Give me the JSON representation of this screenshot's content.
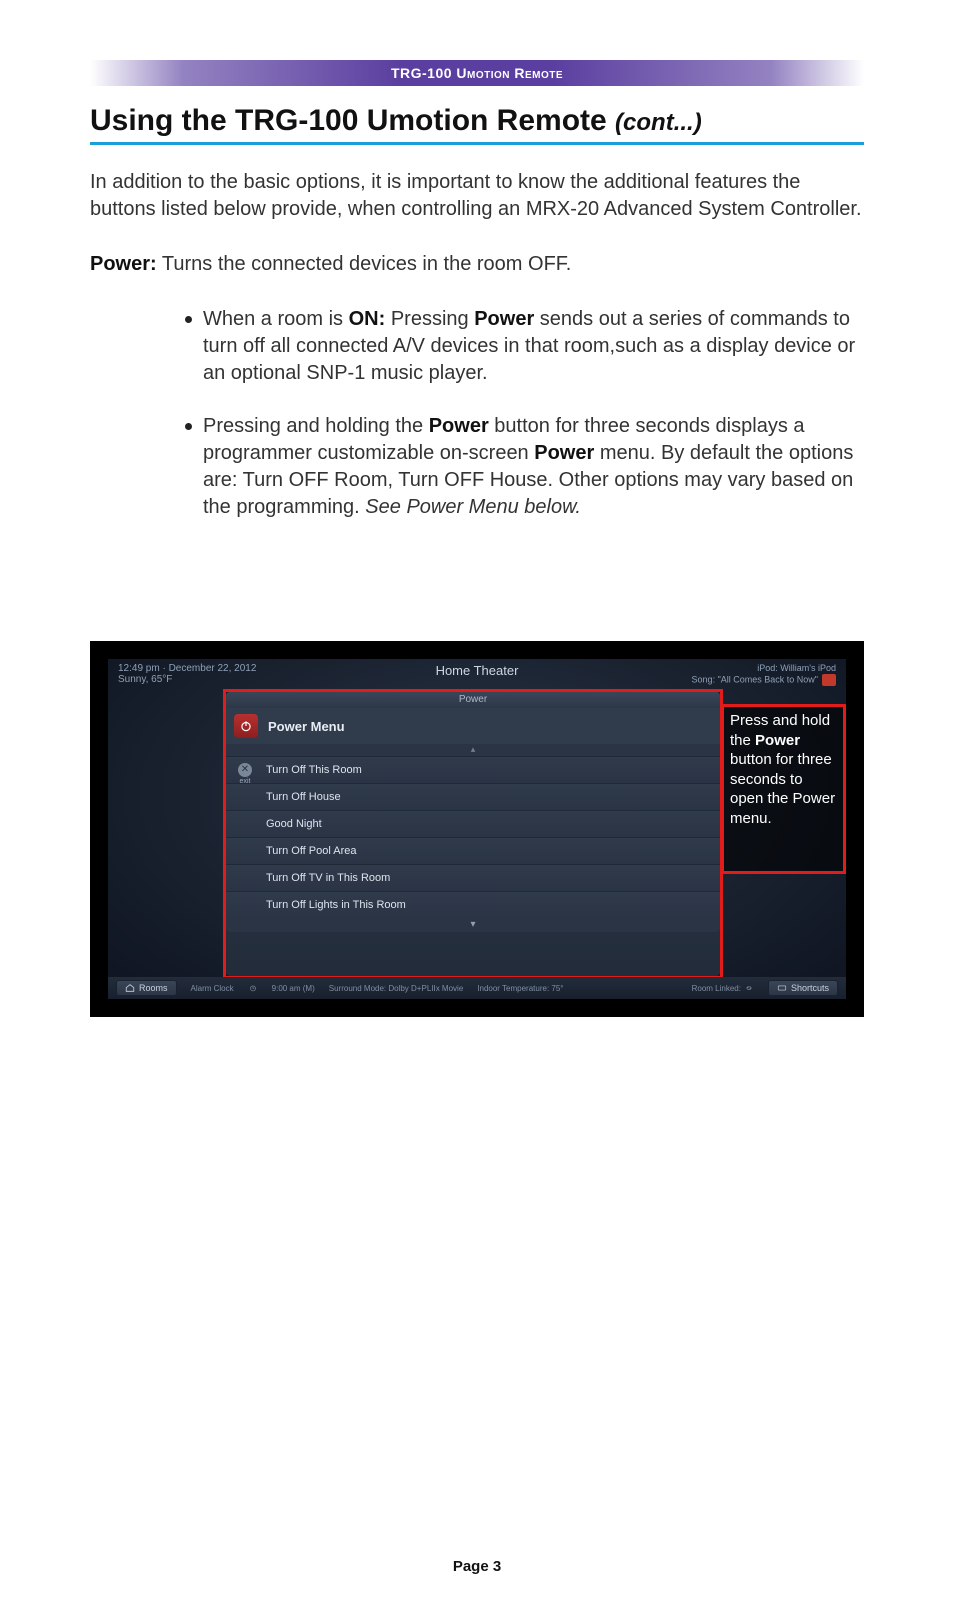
{
  "header_band": "TRG-100 Umotion Remote",
  "title_main": "Using the TRG-100 Umotion Remote ",
  "title_cont": "(cont...)",
  "intro": "In addition to the basic options, it is important to know the additional features the buttons listed below provide, when controlling an MRX-20 Advanced System Controller.",
  "power_label": "Power:",
  "power_desc": " Turns the connected devices in the room OFF.",
  "bullets": {
    "b1_pre": "When a room is ",
    "b1_on": "ON:",
    "b1_mid": " Pressing ",
    "b1_power": "Power",
    "b1_post": " sends out a series of commands to turn off all connected A/V devices in that room,such as a display device or an optional SNP-1 music player.",
    "b2_pre": "Pressing and holding the ",
    "b2_power1": "Power",
    "b2_mid1": " button for three seconds displays a programmer customizable on-screen ",
    "b2_power2": "Power",
    "b2_mid2": " menu. By default the options are: Turn OFF Room, Turn OFF House. Other options may vary based on the programming. ",
    "b2_ital": "See Power Menu below."
  },
  "screenshot": {
    "top_left_time": "12:49 pm · December 22, 2012",
    "top_left_weather": "Sunny, 65°F",
    "top_center": "Home Theater",
    "top_right_line1": "iPod: William's iPod",
    "top_right_line2": "Song: \"All Comes Back to Now\"",
    "tab_label": "Power",
    "menu_title": "Power Menu",
    "exit_label": "exit",
    "items": [
      "Turn Off This Room",
      "Turn Off House",
      "Good Night",
      "Turn Off Pool Area",
      "Turn Off TV in This Room",
      "Turn Off Lights in This Room"
    ],
    "callout_pre": "Press and hold the ",
    "callout_bold": "Power",
    "callout_post": " button for three seconds to open the Power menu.",
    "bottom": {
      "rooms": "Rooms",
      "alarm": "Alarm Clock",
      "alarm_time": "9:00 am (M)",
      "surround": "Surround Mode: Dolby D+PLIIx Movie",
      "temp": "Indoor Temperature: 75°",
      "linked": "Room Linked:",
      "shortcuts": "Shortcuts"
    }
  },
  "page_number": "Page 3"
}
